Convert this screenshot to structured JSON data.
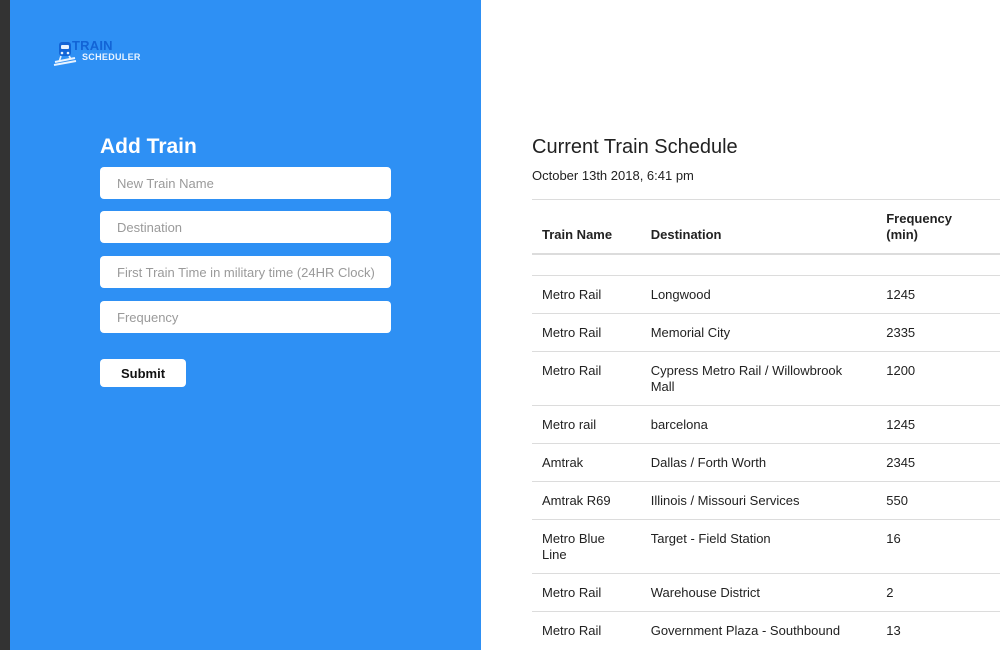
{
  "logo": {
    "line1": "TRAIN",
    "line2": "SCHEDULER"
  },
  "form": {
    "title": "Add Train",
    "fields": [
      {
        "placeholder": "New Train Name",
        "value": ""
      },
      {
        "placeholder": "Destination",
        "value": ""
      },
      {
        "placeholder": "First Train Time in military time (24HR Clock)",
        "value": ""
      },
      {
        "placeholder": "Frequency",
        "value": ""
      }
    ],
    "submit_label": "Submit"
  },
  "schedule": {
    "title": "Current Train Schedule",
    "date": "October 13th 2018, 6:41 pm",
    "columns": [
      "Train Name",
      "Destination",
      "Frequency (min)"
    ],
    "rows": [
      {
        "name": "Metro Rail",
        "destination": "Longwood",
        "frequency": "1245"
      },
      {
        "name": "Metro Rail",
        "destination": "Memorial City",
        "frequency": "2335"
      },
      {
        "name": "Metro Rail",
        "destination": "Cypress Metro Rail / Willowbrook Mall",
        "frequency": "1200"
      },
      {
        "name": "Metro rail",
        "destination": "barcelona",
        "frequency": "1245"
      },
      {
        "name": "Amtrak",
        "destination": "Dallas / Forth Worth",
        "frequency": "2345"
      },
      {
        "name": "Amtrak R69",
        "destination": "Illinois / Missouri Services",
        "frequency": "550"
      },
      {
        "name": "Metro Blue Line",
        "destination": "Target - Field Station",
        "frequency": "16"
      },
      {
        "name": "Metro Rail",
        "destination": "Warehouse District",
        "frequency": "2"
      },
      {
        "name": "Metro Rail",
        "destination": "Government Plaza - Southbound",
        "frequency": "13"
      }
    ]
  },
  "colors": {
    "panel_blue": "#2e90f4",
    "logo_blue": "#1264d6"
  },
  "icons": {
    "logo": "train-icon"
  }
}
